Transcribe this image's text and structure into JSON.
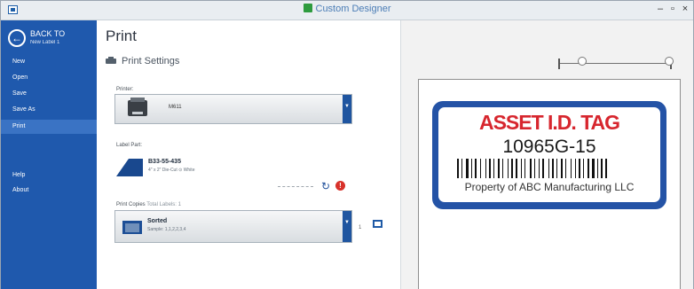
{
  "app": {
    "title": "Custom Designer",
    "window_buttons": [
      "–",
      "▫",
      "×"
    ]
  },
  "sidebar": {
    "back_label": "BACK TO",
    "back_sub": "New Label 1",
    "items": [
      {
        "label": "New"
      },
      {
        "label": "Open"
      },
      {
        "label": "Save"
      },
      {
        "label": "Save As"
      },
      {
        "label": "Print",
        "active": true
      },
      {
        "label": "Help"
      },
      {
        "label": "About"
      }
    ]
  },
  "main": {
    "title": "Print",
    "settings_label": "Print Settings",
    "printer": {
      "label": "Printer:",
      "value": "M611"
    },
    "label_part": {
      "label": "Label Part:",
      "part_number": "B33-55-435",
      "description": "4\" x 2\"  Die-Cut  ⊙ White"
    },
    "copies": {
      "label": "Print Copies",
      "label_suffix": "Total Labels: 1",
      "mode": "Sorted",
      "sample": "Sample: 1,1,2,2,3,4",
      "count": "1"
    }
  },
  "preview": {
    "tag_title": "ASSET I.D. TAG",
    "tag_id": "10965G-15",
    "tag_footer": "Property of ABC Manufacturing LLC"
  },
  "colors": {
    "sidebar": "#1f59ad",
    "accent": "#1f55a0",
    "tag_red": "#d7262e",
    "tag_blue": "#2453a6"
  }
}
